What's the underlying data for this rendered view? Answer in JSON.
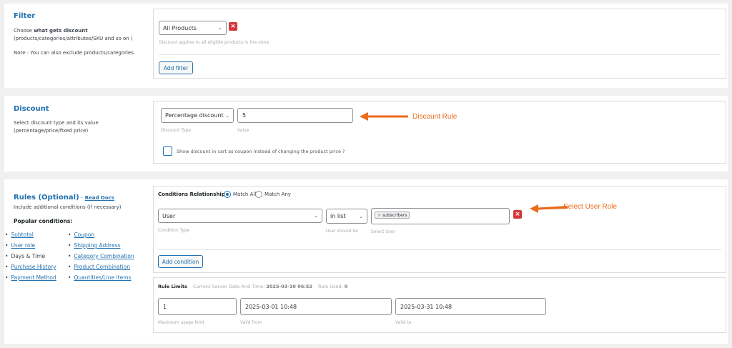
{
  "filter": {
    "title": "Filter",
    "desc_prefix": "Choose ",
    "desc_bold": "what gets discount",
    "desc_rest": "(products/categories/attributes/SKU and so on )",
    "note": "Note : You can also exclude products/categories.",
    "select_value": "All Products",
    "hint": "Discount applies to all eligible products in the store",
    "add_button": "Add filter"
  },
  "discount": {
    "title": "Discount",
    "desc_line1": "Select discount type and its value",
    "desc_line2": "(percentage/price/fixed price)",
    "type_value": "Percentage discount",
    "type_hint": "Discount Type",
    "value": "5",
    "value_hint": "Value",
    "coupon_label": "Show discount in cart as coupon instead of changing the product price ?",
    "annotation": "Discount Rule"
  },
  "rules": {
    "title": "Rules (Optional)",
    "title_sep": " - ",
    "read_docs": "Read Docs",
    "desc": "Include additional conditions (if necessary)",
    "popular_title": "Popular conditions:",
    "popular_left": [
      "Subtotal",
      "User role",
      "Days & Time",
      "Purchase History",
      "Payment Method"
    ],
    "popular_right": [
      "Coupon",
      "Shipping Address",
      "Category Combination",
      "Product Combination",
      "Quantities/Line items"
    ],
    "conditions_label": "Conditions Relationship",
    "match_all": "Match All",
    "match_any": "Match Any",
    "condition_type_value": "User",
    "condition_type_hint": "Condition Type",
    "operator_value": "in list",
    "operator_hint": "User should be",
    "tag_value": "subscribers",
    "tag_hint": "Select User",
    "add_condition": "Add condition",
    "annotation": "Select User Role",
    "limits_title": "Rule Limits",
    "server_date_label": "Current Server Date And Time:",
    "server_date_value": "2025-03-10 06:52",
    "rule_used_label": "Rule Used:",
    "rule_used_value": "0",
    "max_usage_value": "1",
    "max_usage_hint": "Maximum usage limit",
    "valid_from_value": "2025-03-01 10:48",
    "valid_from_hint": "Valid from",
    "valid_to_value": "2025-03-31 10:48",
    "valid_to_hint": "Valid to"
  },
  "colors": {
    "accent": "#2271b1",
    "annotation": "#ec6a1c",
    "remove": "#d63638"
  }
}
